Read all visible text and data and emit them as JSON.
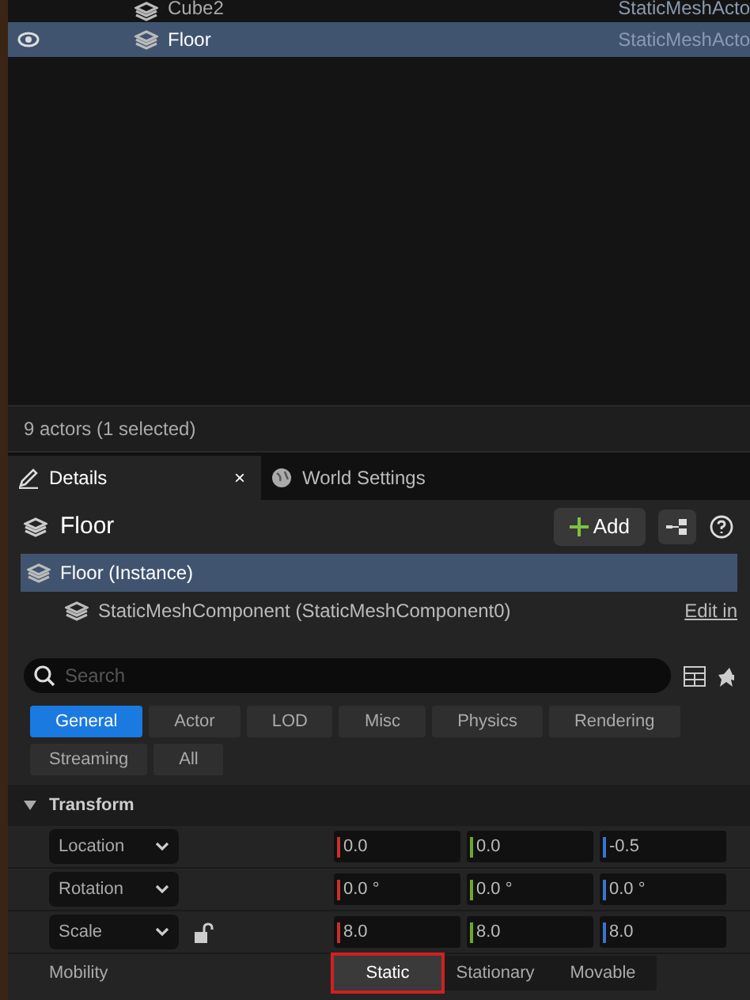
{
  "outliner": {
    "rows": [
      {
        "label": "Cube2",
        "type": "StaticMeshActo",
        "selected": false,
        "visible": false
      },
      {
        "label": "Floor",
        "type": "StaticMeshActo",
        "selected": true,
        "visible": true
      }
    ],
    "status": "9 actors (1 selected)"
  },
  "tabs": [
    {
      "label": "Details",
      "selected": true,
      "close": "×"
    },
    {
      "label": "World Settings",
      "selected": false
    }
  ],
  "details": {
    "title": "Floor",
    "add_button": "Add",
    "components": [
      {
        "label": "Floor (Instance)",
        "selected": true
      },
      {
        "label": "StaticMeshComponent (StaticMeshComponent0)",
        "selected": false,
        "link": "Edit in "
      }
    ],
    "search": {
      "placeholder": "Search"
    },
    "filters": [
      {
        "label": "General",
        "selected": true
      },
      {
        "label": "Actor",
        "selected": false
      },
      {
        "label": "LOD",
        "selected": false
      },
      {
        "label": "Misc",
        "selected": false
      },
      {
        "label": "Physics",
        "selected": false
      },
      {
        "label": "Rendering",
        "selected": false
      },
      {
        "label": "Streaming",
        "selected": false
      },
      {
        "label": "All",
        "selected": false
      }
    ],
    "section": {
      "label": "Transform",
      "expanded": true
    },
    "properties": [
      {
        "label": "Location",
        "lock": false,
        "values": [
          "0.0",
          "0.0",
          "-0.5"
        ]
      },
      {
        "label": "Rotation",
        "lock": false,
        "values": [
          "0.0 °",
          "0.0 °",
          "0.0 °"
        ]
      },
      {
        "label": "Scale",
        "lock": true,
        "values": [
          "8.0",
          "8.0",
          "8.0"
        ]
      }
    ],
    "mobility": {
      "label": "Mobility",
      "options": [
        {
          "label": "Static",
          "selected": true,
          "highlighted": true
        },
        {
          "label": "Stationary",
          "selected": false,
          "highlighted": false
        },
        {
          "label": "Movable",
          "selected": false,
          "highlighted": false
        }
      ]
    }
  }
}
